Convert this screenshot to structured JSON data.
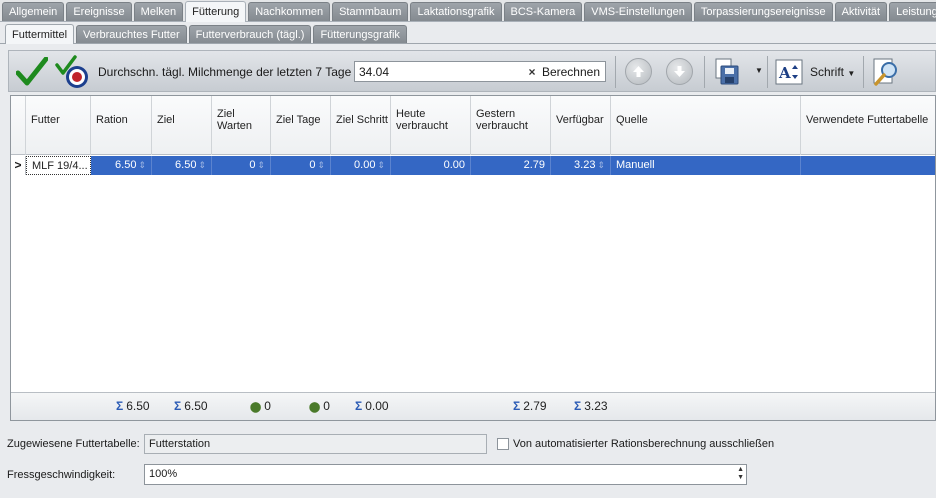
{
  "main_tabs": [
    "Allgemein",
    "Ereignisse",
    "Melken",
    "Fütterung",
    "Nachkommen",
    "Stammbaum",
    "Laktationsgrafik",
    "BCS-Kamera",
    "VMS-Einstellungen",
    "Torpassierungsereignisse",
    "Aktivität",
    "Leistung"
  ],
  "active_main_tab": "Fütterung",
  "sub_tabs": [
    "Futtermittel",
    "Verbrauchtes Futter",
    "Futterverbrauch (tägl.)",
    "Fütterungsgrafik"
  ],
  "active_sub_tab": "Futtermittel",
  "toolbar": {
    "milk_label": "Durchschn. tägl. Milchmenge der letzten 7 Tage",
    "milk_value": "34.04",
    "clear_glyph": "×",
    "calculate_label": "Berechnen",
    "font_label": "Schrift",
    "icons": [
      "check-icon",
      "check-target-icon",
      "arrow-up-icon",
      "arrow-down-icon",
      "save-icon",
      "font-icon",
      "print-preview-icon"
    ],
    "accent_check": "#1e8a1e",
    "accent_target": "#c0242b"
  },
  "grid": {
    "headers": {
      "futter": "Futter",
      "ration": "Ration",
      "ziel": "Ziel",
      "ziel_warten_1": "Ziel",
      "ziel_warten_2": "Warten",
      "ziel_tage": "Ziel Tage",
      "ziel_schritt": "Ziel Schritt",
      "heute_1": "Heute",
      "heute_2": "verbraucht",
      "gestern_1": "Gestern",
      "gestern_2": "verbraucht",
      "verfuegbar": "Verfügbar",
      "quelle": "Quelle",
      "futtertabelle": "Verwendete Futtertabelle"
    },
    "row": {
      "futter": "MLF 19/4...",
      "ration": "6.50",
      "ziel": "6.50",
      "ziel_warten": "0",
      "ziel_tage": "0",
      "ziel_schritt": "0.00",
      "heute": "0.00",
      "gestern": "2.79",
      "verfuegbar": "3.23",
      "quelle": "Manuell",
      "futtertabelle": ""
    },
    "footer": {
      "ration_sum": "6.50",
      "ziel_sum": "6.50",
      "ziel_warten_count": "0",
      "ziel_tage_count": "0",
      "ziel_schritt_sum": "0.00",
      "gestern_sum": "2.79",
      "verfuegbar_sum": "3.23",
      "sigma": "Σ"
    },
    "selection_color": "#3467c4"
  },
  "form": {
    "futtertabelle_label": "Zugewiesene Futtertabelle:",
    "futtertabelle_value": "Futterstation",
    "exclude_label": "Von automatisierter Rationsberechnung ausschließen",
    "speed_label": "Fressgeschwindigkeit:",
    "speed_value": "100%"
  }
}
